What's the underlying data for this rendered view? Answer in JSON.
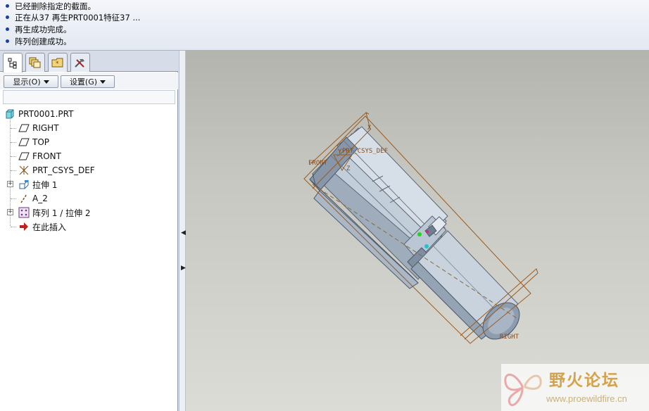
{
  "messages": [
    "已经删除指定的截面。",
    "正在从37 再生PRT0001特征37 ...",
    "再生成功完成。",
    "阵列创建成功。"
  ],
  "tabs": [
    {
      "icon": "model-tree-icon"
    },
    {
      "icon": "layers-icon"
    },
    {
      "icon": "favorites-folder-icon"
    },
    {
      "icon": "tools-icon"
    }
  ],
  "buttons": {
    "show": "显示(O)",
    "settings": "设置(G)"
  },
  "tree": {
    "root": "PRT0001.PRT",
    "items": [
      {
        "label": "RIGHT",
        "icon": "datum-plane-icon"
      },
      {
        "label": "TOP",
        "icon": "datum-plane-icon"
      },
      {
        "label": "FRONT",
        "icon": "datum-plane-icon"
      },
      {
        "label": "PRT_CSYS_DEF",
        "icon": "csys-icon"
      },
      {
        "label": "拉伸 1",
        "icon": "extrude-icon"
      },
      {
        "label": "A_2",
        "icon": "axis-icon"
      },
      {
        "label": "阵列 1 / 拉伸 2",
        "icon": "pattern-icon"
      },
      {
        "label": "在此插入",
        "icon": "insert-here-arrow-icon"
      }
    ]
  },
  "viewport": {
    "datum_labels": {
      "front": "FRONT",
      "csys": "PRT_CSYS_DEF",
      "right": "RIGHT",
      "x": "X",
      "y": "Y",
      "z": "Z"
    }
  },
  "watermark": {
    "title": "野火论坛",
    "url": "www.proewildfire.cn"
  },
  "colors": {
    "datum": "#9a5a1e",
    "part": "#b7c3d1",
    "viewport_top": "#b4b4ae",
    "viewport_bottom": "#dcdcd7"
  }
}
